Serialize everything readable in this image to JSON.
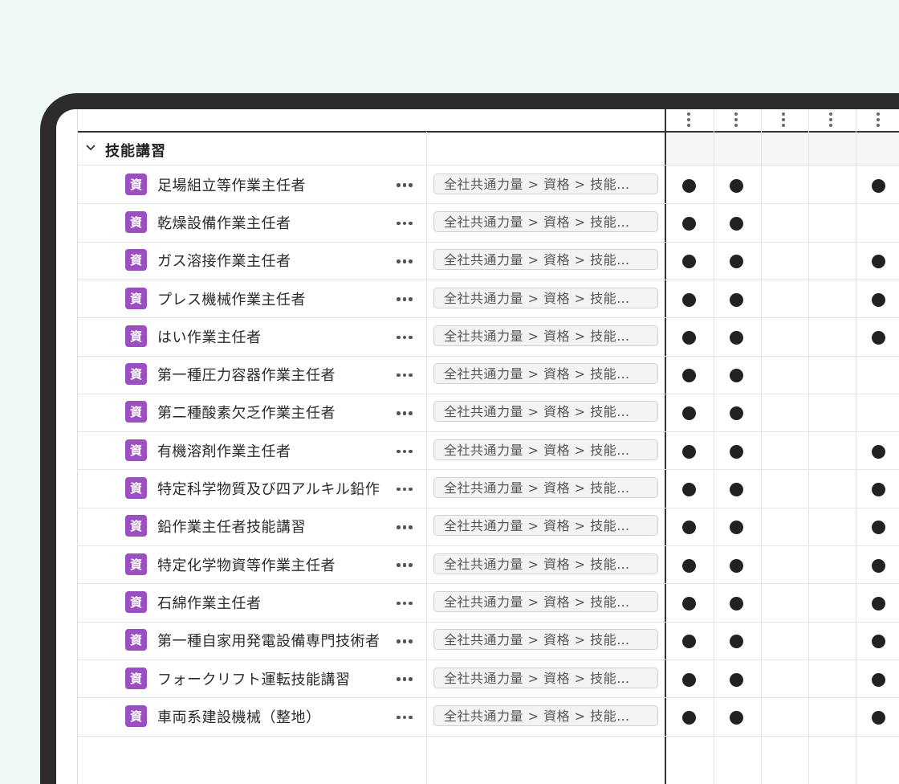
{
  "group": {
    "title": "技能講習"
  },
  "badge_label": "資",
  "path_label": "全社共通力量 > 資格 > 技能…",
  "rows": [
    {
      "name": "足場組立等作業主任者",
      "marks": [
        true,
        true,
        false,
        false,
        true
      ]
    },
    {
      "name": "乾燥設備作業主任者",
      "marks": [
        true,
        true,
        false,
        false,
        false
      ]
    },
    {
      "name": "ガス溶接作業主任者",
      "marks": [
        true,
        true,
        false,
        false,
        true
      ]
    },
    {
      "name": "プレス機械作業主任者",
      "marks": [
        true,
        true,
        false,
        false,
        true
      ]
    },
    {
      "name": "はい作業主任者",
      "marks": [
        true,
        true,
        false,
        false,
        true
      ]
    },
    {
      "name": "第一種圧力容器作業主任者",
      "marks": [
        true,
        true,
        false,
        false,
        false
      ]
    },
    {
      "name": "第二種酸素欠乏作業主任者",
      "marks": [
        true,
        true,
        false,
        false,
        false
      ]
    },
    {
      "name": "有機溶剤作業主任者",
      "marks": [
        true,
        true,
        false,
        false,
        true
      ]
    },
    {
      "name": "特定科学物質及び四アルキル鉛作",
      "marks": [
        true,
        true,
        false,
        false,
        true
      ]
    },
    {
      "name": "鉛作業主任者技能講習",
      "marks": [
        true,
        true,
        false,
        false,
        true
      ]
    },
    {
      "name": "特定化学物資等作業主任者",
      "marks": [
        true,
        true,
        false,
        false,
        true
      ]
    },
    {
      "name": "石綿作業主任者",
      "marks": [
        true,
        true,
        false,
        false,
        true
      ]
    },
    {
      "name": "第一種自家用発電設備専門技術者",
      "marks": [
        true,
        true,
        false,
        false,
        true
      ]
    },
    {
      "name": "フォークリフト運転技能講習",
      "marks": [
        true,
        true,
        false,
        false,
        true
      ]
    },
    {
      "name": "車両系建設機械（整地）",
      "marks": [
        true,
        true,
        false,
        false,
        true
      ]
    }
  ],
  "colors": {
    "badge": "#9b4fc0",
    "background": "#eff9f3",
    "frame": "#2c2c2c"
  }
}
